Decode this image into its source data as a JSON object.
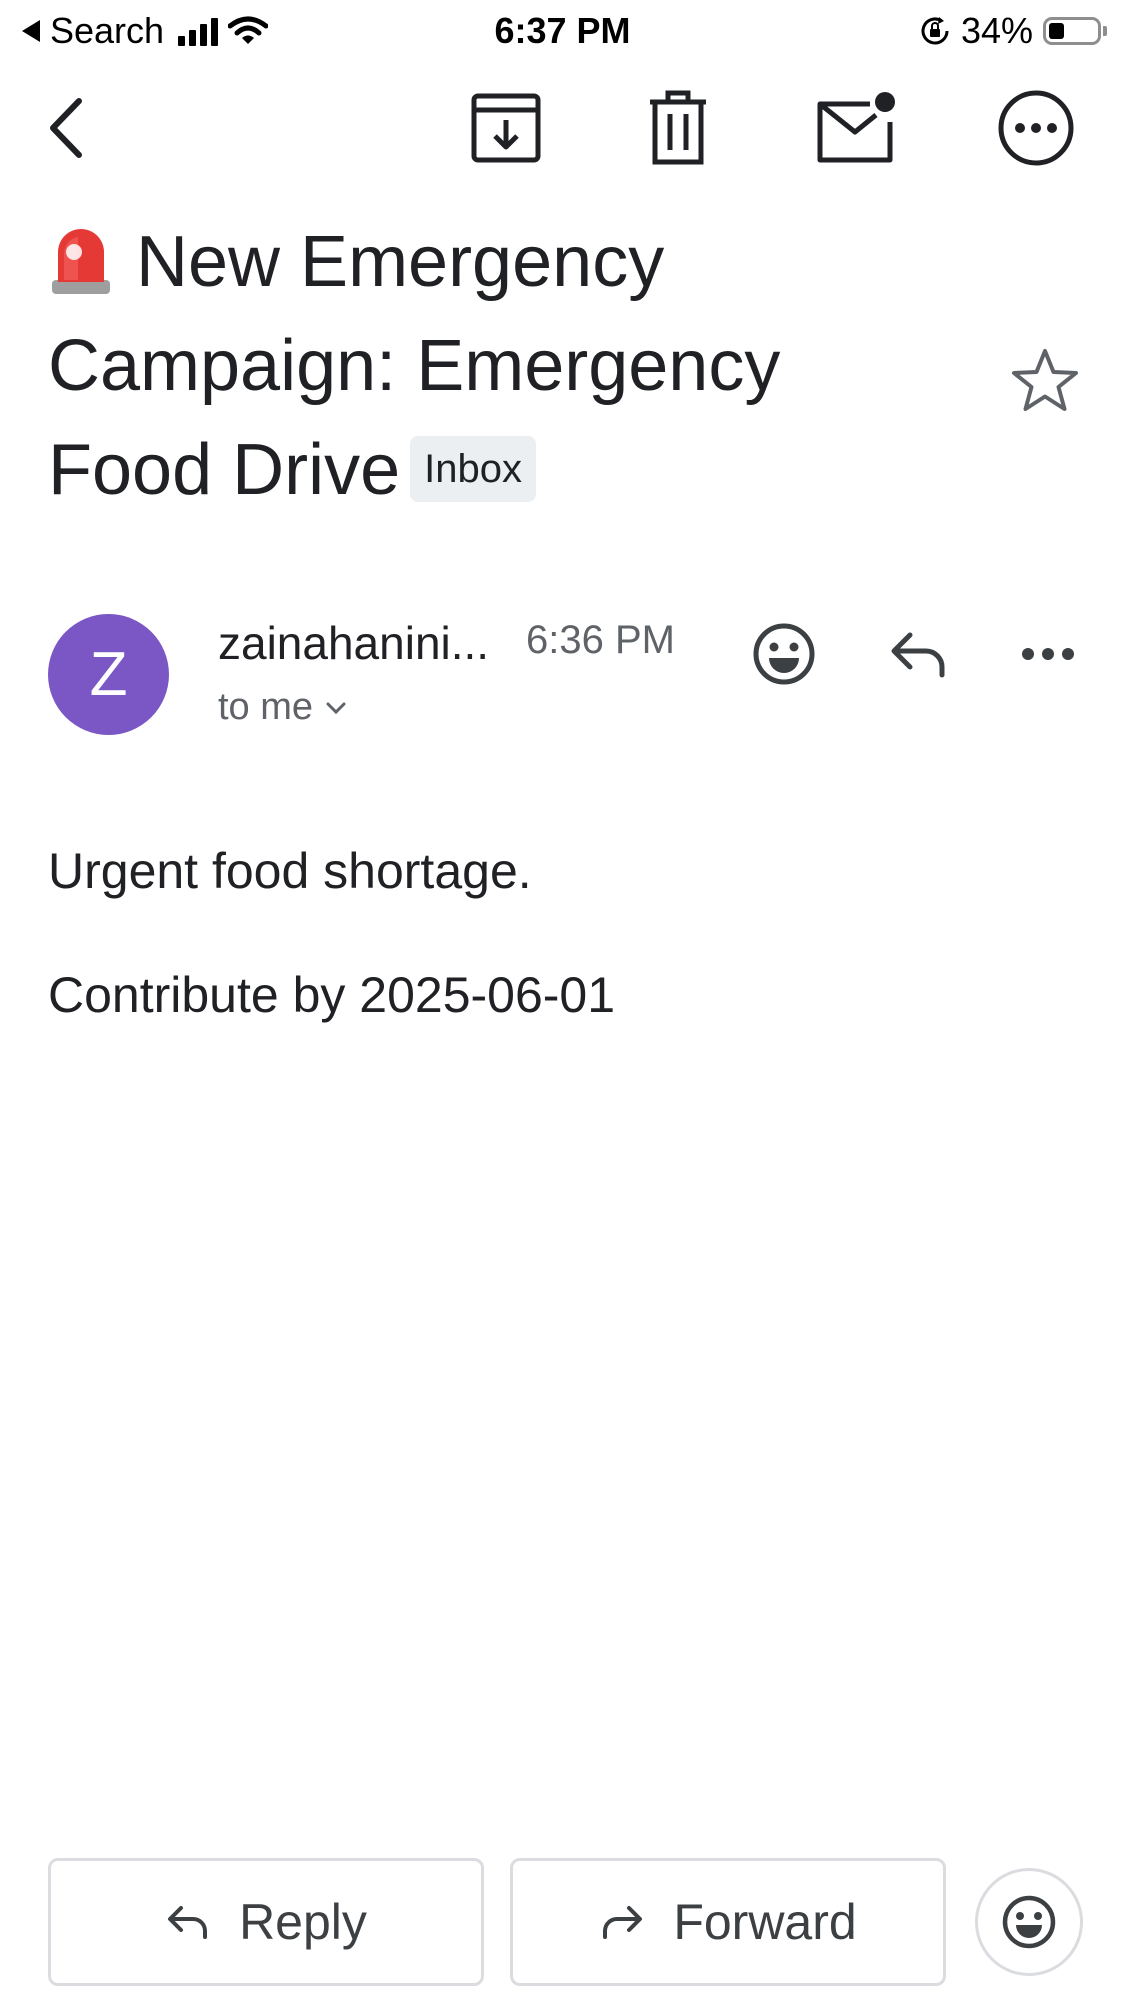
{
  "status_bar": {
    "back_app_label": "Search",
    "time": "6:37 PM",
    "battery_percent": "34%",
    "battery_level": 0.34
  },
  "toolbar": {
    "icons": [
      "back-arrow-icon",
      "archive-icon",
      "delete-icon",
      "mark-unread-icon",
      "more-options-icon"
    ]
  },
  "email": {
    "subject_emoji": "🚨",
    "subject_text": "New Emergency Campaign: Emergency Food Drive",
    "label_chip": "Inbox",
    "starred": false,
    "sender_initial": "Z",
    "sender_name": "zainahanini...",
    "time": "6:36 PM",
    "recipient": "to me",
    "body_lines": [
      "Urgent food shortage.",
      "Contribute by 2025-06-01"
    ]
  },
  "actions": {
    "reply_label": "Reply",
    "forward_label": "Forward"
  },
  "colors": {
    "avatar": "#7b57c6",
    "text_primary": "#202124",
    "text_secondary": "#5f6368",
    "chip_bg": "#eceff1",
    "border": "#dadce0"
  }
}
